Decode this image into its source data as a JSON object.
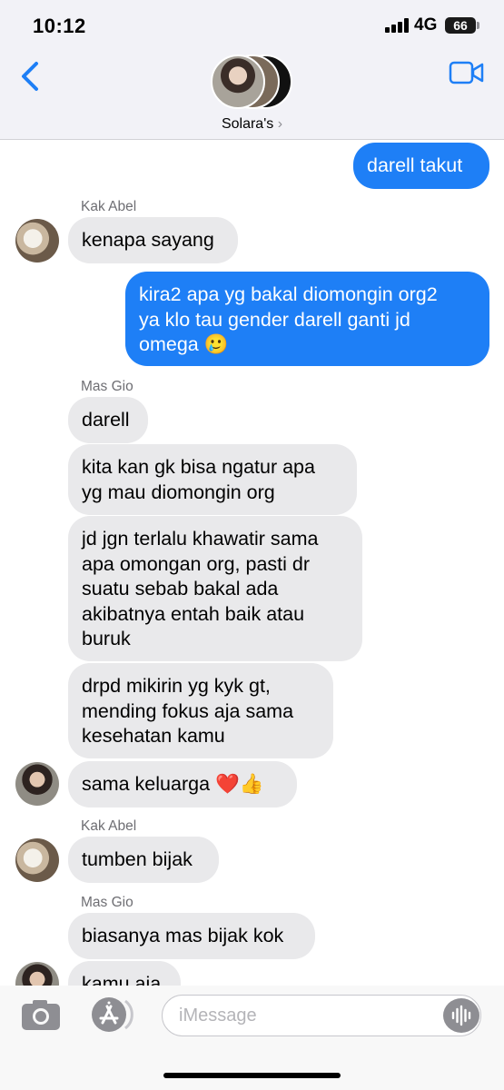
{
  "status_bar": {
    "time": "10:12",
    "network": "4G",
    "battery": "66"
  },
  "header": {
    "group_name": "Solara's",
    "chevron": "›",
    "back_icon": "chevron-left-icon",
    "video_icon": "video-camera-icon"
  },
  "messages": [
    {
      "text": "darell takut",
      "direction": "outgoing"
    },
    {
      "sender": "Kak Abel",
      "text": "kenapa sayang",
      "direction": "incoming"
    },
    {
      "text": "kira2 apa yg bakal diomongin org2\nya klo tau gender darell ganti jd\nomega 🥲",
      "direction": "outgoing"
    },
    {
      "sender": "Mas Gio",
      "text": "darell",
      "direction": "incoming"
    },
    {
      "text": "kita kan gk bisa ngatur apa\nyg mau diomongin org",
      "direction": "incoming"
    },
    {
      "text": "jd jgn terlalu khawatir sama\napa omongan org, pasti dr\nsuatu sebab bakal ada\nakibatnya entah baik atau\nburuk",
      "direction": "incoming"
    },
    {
      "text": "drpd mikirin yg kyk gt,\nmending fokus aja sama\nkesehatan kamu",
      "direction": "incoming"
    },
    {
      "text": "sama keluarga ❤️👍",
      "direction": "incoming"
    },
    {
      "sender": "Kak Abel",
      "text": "tumben bijak",
      "direction": "incoming"
    },
    {
      "sender": "Mas Gio",
      "text": "biasanya mas bijak kok",
      "direction": "incoming"
    },
    {
      "text": "kamu aja",
      "direction": "incoming"
    }
  ],
  "input": {
    "placeholder": "iMessage",
    "value": ""
  },
  "colors": {
    "outgoing_bubble": "#1e7ff6",
    "incoming_bubble": "#e9e9eb",
    "accent": "#1e7ff6"
  }
}
